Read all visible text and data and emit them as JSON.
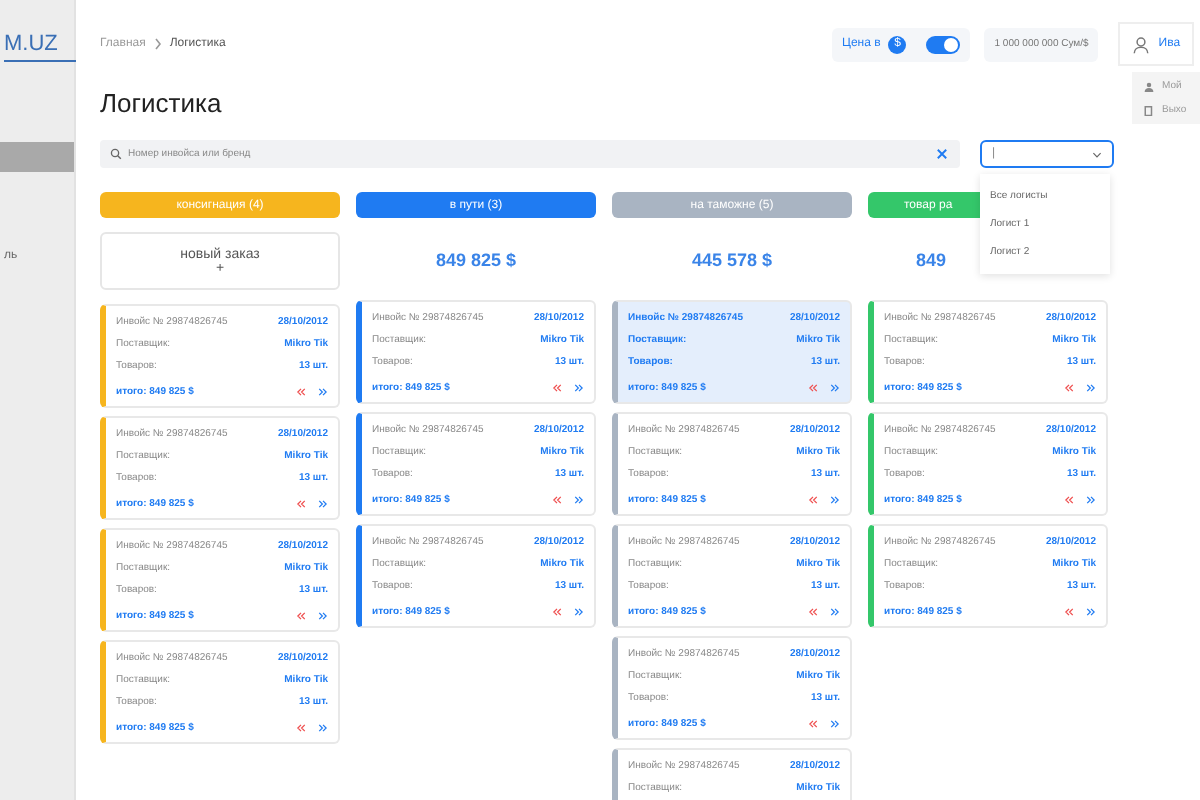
{
  "sidebar": {
    "logo": "M.UZ",
    "items": [
      {
        "selected": true
      },
      {
        "label": "ль",
        "selected": false
      }
    ]
  },
  "breadcrumb": [
    "Главная",
    "Логистика"
  ],
  "price_toggle": {
    "label": "Цена в",
    "currency": "$",
    "on": true
  },
  "rate_field": {
    "value": "1 000 000 000 Сум/$"
  },
  "user": {
    "name": "Ива",
    "menu": [
      {
        "kind": "profile",
        "label": "Мой"
      },
      {
        "kind": "logout",
        "label": "Выхо"
      }
    ]
  },
  "title": "Логистика",
  "search": {
    "placeholder": "Номер инвойса или бренд"
  },
  "logist_select": {
    "value": "|",
    "expanded": true,
    "options": [
      "Все логисты",
      "Логист 1",
      "Логист 2"
    ]
  },
  "columns": [
    {
      "header": "консигнация (4)",
      "color": "#f6b51e",
      "kind": "new",
      "summary": "новый заказ",
      "add": "+",
      "cards": [
        {
          "invoice": "Инвойс № 29874826745",
          "date": "28/10/2012",
          "supplier_label": "Поставщик:",
          "supplier": "Mikro Tik",
          "qty_label": "Товаров:",
          "qty": "13 шт.",
          "total": "итого: 849 825 $",
          "selected": false
        },
        {
          "invoice": "Инвойс № 29874826745",
          "date": "28/10/2012",
          "supplier_label": "Поставщик:",
          "supplier": "Mikro Tik",
          "qty_label": "Товаров:",
          "qty": "13 шт.",
          "total": "итого: 849 825 $",
          "selected": false
        },
        {
          "invoice": "Инвойс № 29874826745",
          "date": "28/10/2012",
          "supplier_label": "Поставщик:",
          "supplier": "Mikro Tik",
          "qty_label": "Товаров:",
          "qty": "13 шт.",
          "total": "итого: 849 825 $",
          "selected": false
        },
        {
          "invoice": "Инвойс № 29874826745",
          "date": "28/10/2012",
          "supplier_label": "Поставщик:",
          "supplier": "Mikro Tik",
          "qty_label": "Товаров:",
          "qty": "13 шт.",
          "total": "итого: 849 825 $",
          "selected": false
        }
      ]
    },
    {
      "header": "в пути (3)",
      "color": "#1f7bf2",
      "kind": "total",
      "summary": "849 825 $",
      "cards": [
        {
          "invoice": "Инвойс № 29874826745",
          "date": "28/10/2012",
          "supplier_label": "Поставщик:",
          "supplier": "Mikro Tik",
          "qty_label": "Товаров:",
          "qty": "13 шт.",
          "total": "итого: 849 825 $",
          "selected": false
        },
        {
          "invoice": "Инвойс № 29874826745",
          "date": "28/10/2012",
          "supplier_label": "Поставщик:",
          "supplier": "Mikro Tik",
          "qty_label": "Товаров:",
          "qty": "13 шт.",
          "total": "итого: 849 825 $",
          "selected": false
        },
        {
          "invoice": "Инвойс № 29874826745",
          "date": "28/10/2012",
          "supplier_label": "Поставщик:",
          "supplier": "Mikro Tik",
          "qty_label": "Товаров:",
          "qty": "13 шт.",
          "total": "итого: 849 825 $",
          "selected": false
        }
      ]
    },
    {
      "header": "на таможне (5)",
      "color": "#a9b4c2",
      "kind": "total",
      "summary": "445 578 $",
      "cards": [
        {
          "invoice": "Инвойс № 29874826745",
          "date": "28/10/2012",
          "supplier_label": "Поставщик:",
          "supplier": "Mikro Tik",
          "qty_label": "Товаров:",
          "qty": "13 шт.",
          "total": "итого: 849 825 $",
          "selected": true
        },
        {
          "invoice": "Инвойс № 29874826745",
          "date": "28/10/2012",
          "supplier_label": "Поставщик:",
          "supplier": "Mikro Tik",
          "qty_label": "Товаров:",
          "qty": "13 шт.",
          "total": "итого: 849 825 $",
          "selected": false
        },
        {
          "invoice": "Инвойс № 29874826745",
          "date": "28/10/2012",
          "supplier_label": "Поставщик:",
          "supplier": "Mikro Tik",
          "qty_label": "Товаров:",
          "qty": "13 шт.",
          "total": "итого: 849 825 $",
          "selected": false
        },
        {
          "invoice": "Инвойс № 29874826745",
          "date": "28/10/2012",
          "supplier_label": "Поставщик:",
          "supplier": "Mikro Tik",
          "qty_label": "Товаров:",
          "qty": "13 шт.",
          "total": "итого: 849 825 $",
          "selected": false
        },
        {
          "invoice": "Инвойс № 29874826745",
          "date": "28/10/2012",
          "supplier_label": "Поставщик:",
          "supplier": "Mikro Tik",
          "selected": false
        }
      ]
    },
    {
      "header": "товар ра",
      "color": "#34c76a",
      "kind": "total",
      "summary": "849",
      "cards": [
        {
          "invoice": "Инвойс № 29874826745",
          "date": "28/10/2012",
          "supplier_label": "Поставщик:",
          "supplier": "Mikro Tik",
          "qty_label": "Товаров:",
          "qty": "13 шт.",
          "total": "итого: 849 825 $",
          "selected": false
        },
        {
          "invoice": "Инвойс № 29874826745",
          "date": "28/10/2012",
          "supplier_label": "Поставщик:",
          "supplier": "Mikro Tik",
          "qty_label": "Товаров:",
          "qty": "13 шт.",
          "total": "итого: 849 825 $",
          "selected": false
        },
        {
          "invoice": "Инвойс № 29874826745",
          "date": "28/10/2012",
          "supplier_label": "Поставщик:",
          "supplier": "Mikro Tik",
          "qty_label": "Товаров:",
          "qty": "13 шт.",
          "total": "итого: 849 825 $",
          "selected": false
        }
      ]
    }
  ]
}
